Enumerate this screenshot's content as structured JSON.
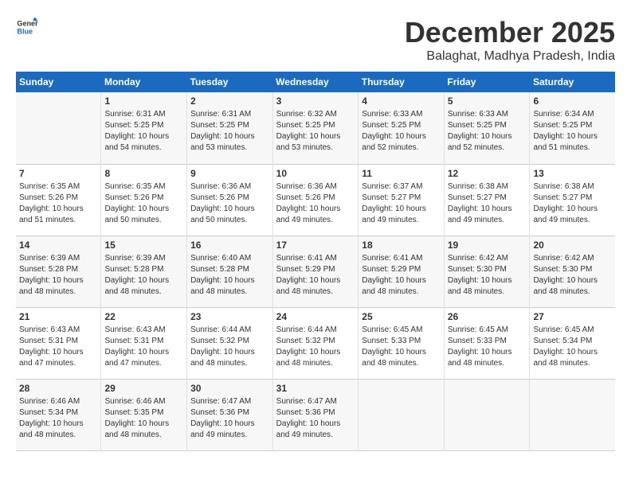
{
  "logo": {
    "line1": "General",
    "line2": "Blue"
  },
  "title": "December 2025",
  "subtitle": "Balaghat, Madhya Pradesh, India",
  "days_header": [
    "Sunday",
    "Monday",
    "Tuesday",
    "Wednesday",
    "Thursday",
    "Friday",
    "Saturday"
  ],
  "weeks": [
    [
      {
        "day": "",
        "info": ""
      },
      {
        "day": "1",
        "info": "Sunrise: 6:31 AM\nSunset: 5:25 PM\nDaylight: 10 hours\nand 54 minutes."
      },
      {
        "day": "2",
        "info": "Sunrise: 6:31 AM\nSunset: 5:25 PM\nDaylight: 10 hours\nand 53 minutes."
      },
      {
        "day": "3",
        "info": "Sunrise: 6:32 AM\nSunset: 5:25 PM\nDaylight: 10 hours\nand 53 minutes."
      },
      {
        "day": "4",
        "info": "Sunrise: 6:33 AM\nSunset: 5:25 PM\nDaylight: 10 hours\nand 52 minutes."
      },
      {
        "day": "5",
        "info": "Sunrise: 6:33 AM\nSunset: 5:25 PM\nDaylight: 10 hours\nand 52 minutes."
      },
      {
        "day": "6",
        "info": "Sunrise: 6:34 AM\nSunset: 5:25 PM\nDaylight: 10 hours\nand 51 minutes."
      }
    ],
    [
      {
        "day": "7",
        "info": "Sunrise: 6:35 AM\nSunset: 5:26 PM\nDaylight: 10 hours\nand 51 minutes."
      },
      {
        "day": "8",
        "info": "Sunrise: 6:35 AM\nSunset: 5:26 PM\nDaylight: 10 hours\nand 50 minutes."
      },
      {
        "day": "9",
        "info": "Sunrise: 6:36 AM\nSunset: 5:26 PM\nDaylight: 10 hours\nand 50 minutes."
      },
      {
        "day": "10",
        "info": "Sunrise: 6:36 AM\nSunset: 5:26 PM\nDaylight: 10 hours\nand 49 minutes."
      },
      {
        "day": "11",
        "info": "Sunrise: 6:37 AM\nSunset: 5:27 PM\nDaylight: 10 hours\nand 49 minutes."
      },
      {
        "day": "12",
        "info": "Sunrise: 6:38 AM\nSunset: 5:27 PM\nDaylight: 10 hours\nand 49 minutes."
      },
      {
        "day": "13",
        "info": "Sunrise: 6:38 AM\nSunset: 5:27 PM\nDaylight: 10 hours\nand 49 minutes."
      }
    ],
    [
      {
        "day": "14",
        "info": "Sunrise: 6:39 AM\nSunset: 5:28 PM\nDaylight: 10 hours\nand 48 minutes."
      },
      {
        "day": "15",
        "info": "Sunrise: 6:39 AM\nSunset: 5:28 PM\nDaylight: 10 hours\nand 48 minutes."
      },
      {
        "day": "16",
        "info": "Sunrise: 6:40 AM\nSunset: 5:28 PM\nDaylight: 10 hours\nand 48 minutes."
      },
      {
        "day": "17",
        "info": "Sunrise: 6:41 AM\nSunset: 5:29 PM\nDaylight: 10 hours\nand 48 minutes."
      },
      {
        "day": "18",
        "info": "Sunrise: 6:41 AM\nSunset: 5:29 PM\nDaylight: 10 hours\nand 48 minutes."
      },
      {
        "day": "19",
        "info": "Sunrise: 6:42 AM\nSunset: 5:30 PM\nDaylight: 10 hours\nand 48 minutes."
      },
      {
        "day": "20",
        "info": "Sunrise: 6:42 AM\nSunset: 5:30 PM\nDaylight: 10 hours\nand 48 minutes."
      }
    ],
    [
      {
        "day": "21",
        "info": "Sunrise: 6:43 AM\nSunset: 5:31 PM\nDaylight: 10 hours\nand 47 minutes."
      },
      {
        "day": "22",
        "info": "Sunrise: 6:43 AM\nSunset: 5:31 PM\nDaylight: 10 hours\nand 47 minutes."
      },
      {
        "day": "23",
        "info": "Sunrise: 6:44 AM\nSunset: 5:32 PM\nDaylight: 10 hours\nand 48 minutes."
      },
      {
        "day": "24",
        "info": "Sunrise: 6:44 AM\nSunset: 5:32 PM\nDaylight: 10 hours\nand 48 minutes."
      },
      {
        "day": "25",
        "info": "Sunrise: 6:45 AM\nSunset: 5:33 PM\nDaylight: 10 hours\nand 48 minutes."
      },
      {
        "day": "26",
        "info": "Sunrise: 6:45 AM\nSunset: 5:33 PM\nDaylight: 10 hours\nand 48 minutes."
      },
      {
        "day": "27",
        "info": "Sunrise: 6:45 AM\nSunset: 5:34 PM\nDaylight: 10 hours\nand 48 minutes."
      }
    ],
    [
      {
        "day": "28",
        "info": "Sunrise: 6:46 AM\nSunset: 5:34 PM\nDaylight: 10 hours\nand 48 minutes."
      },
      {
        "day": "29",
        "info": "Sunrise: 6:46 AM\nSunset: 5:35 PM\nDaylight: 10 hours\nand 48 minutes."
      },
      {
        "day": "30",
        "info": "Sunrise: 6:47 AM\nSunset: 5:36 PM\nDaylight: 10 hours\nand 49 minutes."
      },
      {
        "day": "31",
        "info": "Sunrise: 6:47 AM\nSunset: 5:36 PM\nDaylight: 10 hours\nand 49 minutes."
      },
      {
        "day": "",
        "info": ""
      },
      {
        "day": "",
        "info": ""
      },
      {
        "day": "",
        "info": ""
      }
    ]
  ]
}
